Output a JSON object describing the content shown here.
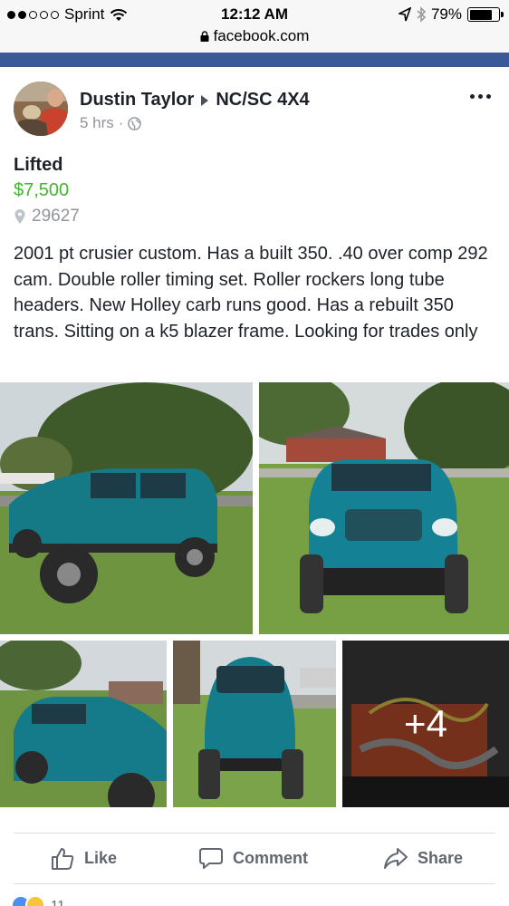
{
  "status_bar": {
    "carrier": "Sprint",
    "time": "12:12 AM",
    "battery": "79%",
    "battery_level": 0.79
  },
  "browser": {
    "url": "facebook.com",
    "brand_color": "#3b5998"
  },
  "post": {
    "author": "Dustin Taylor",
    "group": "NC/SC 4X4",
    "time": "5 hrs",
    "privacy_icon": "globe-icon",
    "more_icon": "more-options-icon"
  },
  "listing": {
    "title": "Lifted",
    "price": "$7,500",
    "price_color": "#42b72a",
    "location": "29627",
    "description": "2001 pt crusier custom. Has a built 350. .40 over comp 292 cam. Double roller timing set. Roller rockers long tube headers. New Holley carb runs good. Has a rebuilt 350 trans. Sitting on a k5 blazer frame. Looking for trades only"
  },
  "photos": {
    "more_count": "+4"
  },
  "actions": {
    "like": "Like",
    "comment": "Comment",
    "share": "Share"
  },
  "reactions": {
    "count": "11"
  }
}
